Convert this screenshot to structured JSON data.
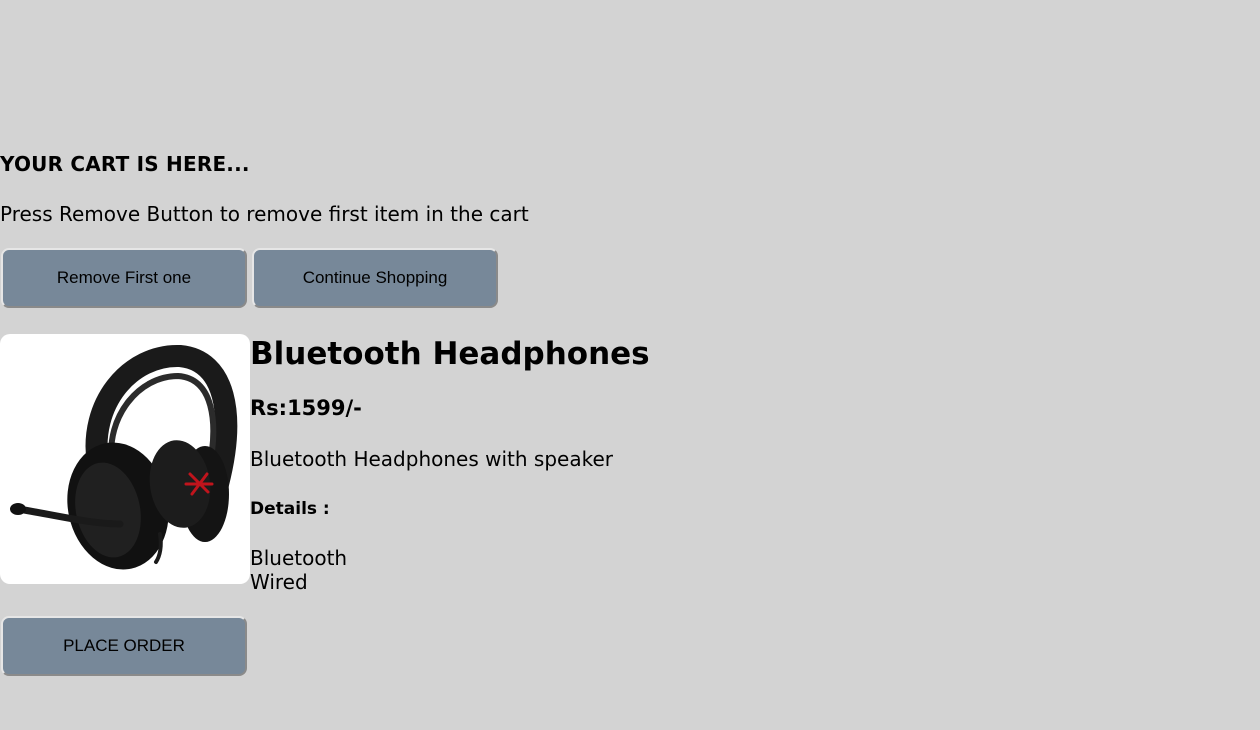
{
  "cart": {
    "heading": "YOUR CART IS HERE...",
    "instructions": "Press Remove Button to remove first item in the cart",
    "remove_button_label": "Remove First one",
    "continue_button_label": "Continue Shopping",
    "place_order_label": "PLACE ORDER"
  },
  "product": {
    "name": "Bluetooth Headphones",
    "price": "Rs:1599/-",
    "description": "Bluetooth Headphones with speaker",
    "details_label": "Details :",
    "specs": [
      "Bluetooth",
      "Wired"
    ],
    "image_icon": "headphones-image"
  },
  "colors": {
    "background": "#d3d3d3",
    "button": "#778899",
    "image_background": "#ffffff",
    "headphone_body": "#1a1a1a",
    "headphone_accent": "#c0141c"
  }
}
